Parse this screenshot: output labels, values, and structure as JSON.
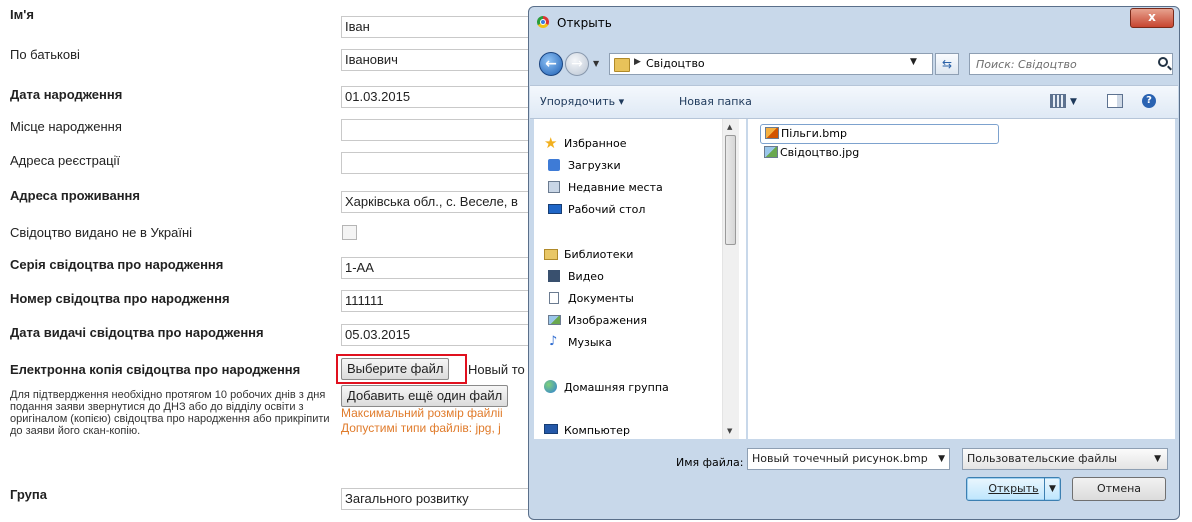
{
  "form": {
    "fields": [
      {
        "label": "Ім'я",
        "value": "Іван"
      },
      {
        "label": "По батькові",
        "value": "Іванович"
      },
      {
        "label": "Дата народження",
        "value": "01.03.2015"
      },
      {
        "label": "Місце народження",
        "value": ""
      },
      {
        "label": "Адреса реєстрації",
        "value": ""
      },
      {
        "label": "Адреса проживання",
        "value": "Харківська обл., с. Веселе, в"
      },
      {
        "label": "Свідоцтво видано не в Україні"
      },
      {
        "label": "Серія свідоцтва про народження",
        "value": "1-АА"
      },
      {
        "label": "Номер свідоцтва про народження",
        "value": "111111"
      },
      {
        "label": "Дата видачі свідоцтва про народження",
        "value": "05.03.2015"
      },
      {
        "label": "Електронна копія свідоцтва про народження"
      },
      {
        "label": "Група",
        "value": "Загального розвитку"
      }
    ],
    "file_button": "Выберите файл",
    "file_chosen": "Новый то",
    "add_file_button": "Добавить ещё один файл",
    "max_size_text": "Максимальний розмір файліі",
    "allowed_types_text": "Допустимі типи файлів: jpg, j",
    "note": "Для підтвердження необхідно протягом 10 робочих днів з дня подання заяви звернутися до ДНЗ або до відділу освіти з оригіналом (копією) свідоцтва про народження або прикріпити до заяви його скан-копію."
  },
  "dialog": {
    "title": "Открыть",
    "close_label": "x",
    "path": "Свідоцтво",
    "search_placeholder": "Поиск: Свідоцтво",
    "toolbar": {
      "organize": "Упорядочить ▾",
      "new_folder": "Новая папка"
    },
    "nav": [
      {
        "label": "Избранное",
        "icon": "star-icon"
      },
      {
        "label": "Загрузки",
        "icon": "downloads-icon"
      },
      {
        "label": "Недавние места",
        "icon": "recent-places-icon"
      },
      {
        "label": "Рабочий стол",
        "icon": "desktop-icon"
      },
      {
        "label": "Библиотеки",
        "icon": "libraries-icon"
      },
      {
        "label": "Видео",
        "icon": "video-icon"
      },
      {
        "label": "Документы",
        "icon": "documents-icon"
      },
      {
        "label": "Изображения",
        "icon": "pictures-icon"
      },
      {
        "label": "Музыка",
        "icon": "music-icon"
      },
      {
        "label": "Домашняя группа",
        "icon": "homegroup-icon"
      },
      {
        "label": "Компьютер",
        "icon": "computer-icon"
      }
    ],
    "files": [
      {
        "name": "Пільги.bmp",
        "selected": true
      },
      {
        "name": "Свідоцтво.jpg",
        "selected": false
      }
    ],
    "filename_label": "Имя файла:",
    "filename_value": "Новый точечный рисунок.bmp",
    "filetype_value": "Пользовательские файлы",
    "open_button": "Открыть",
    "cancel_button": "Отмена"
  },
  "colors": {
    "highlight": "#e0101e",
    "orange_text": "#e07b2b"
  }
}
